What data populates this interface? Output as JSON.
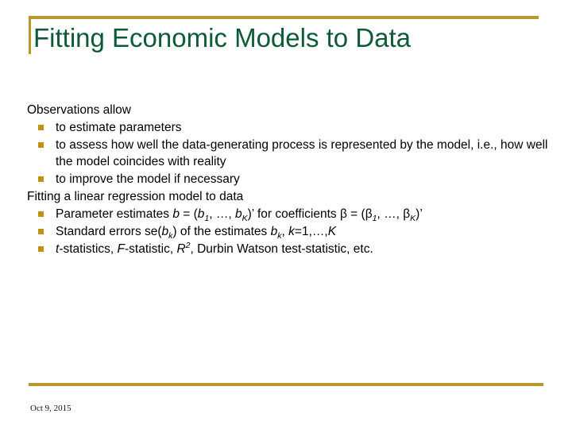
{
  "slide": {
    "title": "Fitting Economic Models to Data",
    "accent_gold": "#b8982e",
    "bullet_gold": "#bf9214",
    "title_green": "#0d5b36",
    "body": {
      "intro_heading": "Observations allow",
      "intro_bullets": [
        "to estimate parameters",
        "to assess how well the data-generating process is represented by the model, i.e., how well the model coincides with reality",
        "to improve the model if necessary"
      ],
      "second_heading": "Fitting a linear regression model to data",
      "fit_bullets": [
        {
          "parts": [
            {
              "t": "Parameter estimates ",
              "s": "plain"
            },
            {
              "t": "b",
              "s": "italic"
            },
            {
              "t": " = (",
              "s": "plain"
            },
            {
              "t": "b",
              "s": "italic"
            },
            {
              "t": "1",
              "s": "sub"
            },
            {
              "t": ", …, ",
              "s": "plain"
            },
            {
              "t": "b",
              "s": "italic"
            },
            {
              "t": "K",
              "s": "sub"
            },
            {
              "t": ")’ for coefficients ",
              "s": "plain"
            },
            {
              "t": "β",
              "s": "greek"
            },
            {
              "t": "  = (",
              "s": "plain"
            },
            {
              "t": "β",
              "s": "greek"
            },
            {
              "t": "1",
              "s": "sub"
            },
            {
              "t": ", …, ",
              "s": "plain"
            },
            {
              "t": "β",
              "s": "greek"
            },
            {
              "t": "K",
              "s": "sub"
            },
            {
              "t": ")’",
              "s": "plain"
            }
          ],
          "plain_text": "Parameter estimates b = (b1, …, bK)’ for coefficients β = (β1, …, βK)’"
        },
        {
          "parts": [
            {
              "t": "Standard errors se(",
              "s": "plain"
            },
            {
              "t": "b",
              "s": "italic"
            },
            {
              "t": "k",
              "s": "sub"
            },
            {
              "t": ") of the estimates ",
              "s": "plain"
            },
            {
              "t": "b",
              "s": "italic"
            },
            {
              "t": "k",
              "s": "sub"
            },
            {
              "t": ", ",
              "s": "plain"
            },
            {
              "t": "k",
              "s": "italic"
            },
            {
              "t": "=1,…,",
              "s": "plain"
            },
            {
              "t": "K",
              "s": "italic"
            }
          ],
          "plain_text": "Standard errors se(bk) of the estimates bk, k=1,…,K"
        },
        {
          "parts": [
            {
              "t": "t",
              "s": "italic"
            },
            {
              "t": "-statistics, ",
              "s": "plain"
            },
            {
              "t": "F",
              "s": "italic"
            },
            {
              "t": "-statistic, ",
              "s": "plain"
            },
            {
              "t": "R",
              "s": "italic"
            },
            {
              "t": "2",
              "s": "sup"
            },
            {
              "t": ", Durbin Watson test-statistic, etc.",
              "s": "plain"
            }
          ],
          "plain_text": "t-statistics, F-statistic, R2, Durbin Watson test-statistic, etc."
        }
      ]
    },
    "footer": {
      "date": "Oct 9, 2015"
    }
  }
}
